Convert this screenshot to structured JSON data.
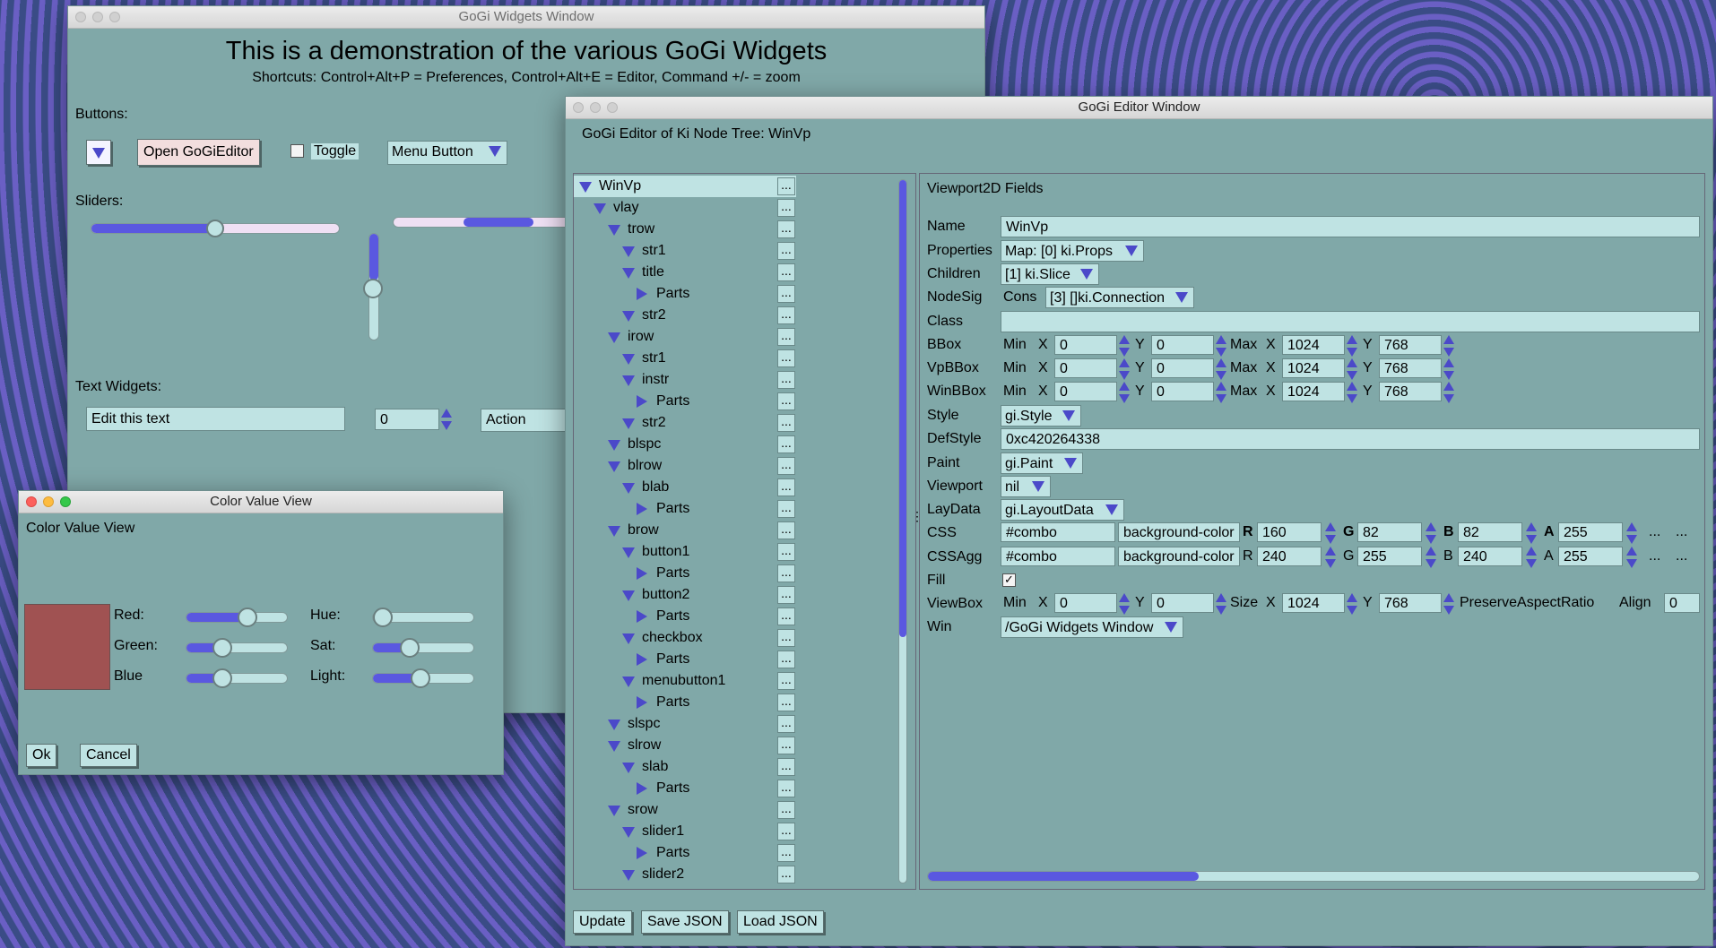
{
  "widgets_window": {
    "title": "GoGi Widgets Window",
    "heading": "This is a demonstration of the various GoGi Widgets",
    "shortcuts": "Shortcuts: Control+Alt+P = Preferences, Control+Alt+E = Editor, Command +/- = zoom",
    "buttons_label": "Buttons:",
    "open_editor": "Open GoGiEditor",
    "toggle": "Toggle",
    "menu_button": "Menu Button",
    "sliders_label": "Sliders:",
    "text_widgets_label": "Text Widgets:",
    "edit_text": "Edit this text",
    "spin_value": "0",
    "action": "Action"
  },
  "color_window": {
    "title": "Color Value View",
    "header": "Color Value View",
    "swatch_color": "#a05252",
    "red_label": "Red:",
    "green_label": "Green:",
    "blue_label": "Blue",
    "hue_label": "Hue:",
    "sat_label": "Sat:",
    "light_label": "Light:",
    "red_level": 0.63,
    "green_level": 0.32,
    "blue_level": 0.32,
    "hue_level": 0.0,
    "sat_level": 0.33,
    "light_level": 0.47,
    "ok": "Ok",
    "cancel": "Cancel"
  },
  "editor_window": {
    "title": "GoGi Editor Window",
    "heading": "GoGi Editor of Ki Node Tree: WinVp",
    "tree": [
      {
        "label": "WinVp",
        "depth": 0,
        "open": true
      },
      {
        "label": "vlay",
        "depth": 1,
        "open": true
      },
      {
        "label": "trow",
        "depth": 2,
        "open": true
      },
      {
        "label": "str1",
        "depth": 3,
        "open": true
      },
      {
        "label": "title",
        "depth": 3,
        "open": true
      },
      {
        "label": "Parts",
        "depth": 4,
        "open": false
      },
      {
        "label": "str2",
        "depth": 3,
        "open": true
      },
      {
        "label": "irow",
        "depth": 2,
        "open": true
      },
      {
        "label": "str1",
        "depth": 3,
        "open": true
      },
      {
        "label": "instr",
        "depth": 3,
        "open": true
      },
      {
        "label": "Parts",
        "depth": 4,
        "open": false
      },
      {
        "label": "str2",
        "depth": 3,
        "open": true
      },
      {
        "label": "blspc",
        "depth": 2,
        "open": true
      },
      {
        "label": "blrow",
        "depth": 2,
        "open": true
      },
      {
        "label": "blab",
        "depth": 3,
        "open": true
      },
      {
        "label": "Parts",
        "depth": 4,
        "open": false
      },
      {
        "label": "brow",
        "depth": 2,
        "open": true
      },
      {
        "label": "button1",
        "depth": 3,
        "open": true
      },
      {
        "label": "Parts",
        "depth": 4,
        "open": false
      },
      {
        "label": "button2",
        "depth": 3,
        "open": true
      },
      {
        "label": "Parts",
        "depth": 4,
        "open": false
      },
      {
        "label": "checkbox",
        "depth": 3,
        "open": true
      },
      {
        "label": "Parts",
        "depth": 4,
        "open": false
      },
      {
        "label": "menubutton1",
        "depth": 3,
        "open": true
      },
      {
        "label": "Parts",
        "depth": 4,
        "open": false
      },
      {
        "label": "slspc",
        "depth": 2,
        "open": true
      },
      {
        "label": "slrow",
        "depth": 2,
        "open": true
      },
      {
        "label": "slab",
        "depth": 3,
        "open": true
      },
      {
        "label": "Parts",
        "depth": 4,
        "open": false
      },
      {
        "label": "srow",
        "depth": 2,
        "open": true
      },
      {
        "label": "slider1",
        "depth": 3,
        "open": true
      },
      {
        "label": "Parts",
        "depth": 4,
        "open": false
      },
      {
        "label": "slider2",
        "depth": 3,
        "open": true
      }
    ],
    "tree_dots": "...",
    "fields_title": "Viewport2D Fields",
    "labels": {
      "name": "Name",
      "properties": "Properties",
      "children": "Children",
      "nodesig": "NodeSig",
      "class": "Class",
      "bbox": "BBox",
      "vpbbox": "VpBBox",
      "winbbox": "WinBBox",
      "style": "Style",
      "defstyle": "DefStyle",
      "paint": "Paint",
      "viewport": "Viewport",
      "laydata": "LayData",
      "css": "CSS",
      "cssagg": "CSSAgg",
      "fill": "Fill",
      "viewbox": "ViewBox",
      "win": "Win"
    },
    "values": {
      "name": "WinVp",
      "properties": "Map: [0] ki.Props",
      "children": "[1] ki.Slice",
      "cons": "Cons",
      "nodesig": "[3] []ki.Connection",
      "class": "",
      "style": "gi.Style",
      "defstyle": "0xc420264338",
      "paint": "gi.Paint",
      "viewport": "nil",
      "laydata": "gi.LayoutData",
      "win": "/GoGi Widgets Window"
    },
    "bbox_words": {
      "min": "Min",
      "max": "Max",
      "x": "X",
      "y": "Y",
      "size": "Size"
    },
    "bbox": {
      "minx": "0",
      "miny": "0",
      "maxx": "1024",
      "maxy": "768"
    },
    "vpbbox": {
      "minx": "0",
      "miny": "0",
      "maxx": "1024",
      "maxy": "768"
    },
    "winbbox": {
      "minx": "0",
      "miny": "0",
      "maxx": "1024",
      "maxy": "768"
    },
    "css": {
      "key": "#combo",
      "prop": "background-color",
      "r": "160",
      "g": "82",
      "b": "82",
      "a": "255"
    },
    "cssagg": {
      "key": "#combo",
      "prop": "background-color",
      "r": "240",
      "g": "255",
      "b": "240",
      "a": "255"
    },
    "rgba_letters": {
      "r": "R",
      "g": "G",
      "b": "B",
      "a": "A"
    },
    "dots": "...",
    "fill_checked": "✓",
    "viewbox": {
      "minx": "0",
      "miny": "0",
      "sizex": "1024",
      "sizey": "768",
      "preserve": "PreserveAspectRatio",
      "align": "Align",
      "align_val": "0"
    },
    "update": "Update",
    "save_json": "Save JSON",
    "load_json": "Load JSON"
  }
}
